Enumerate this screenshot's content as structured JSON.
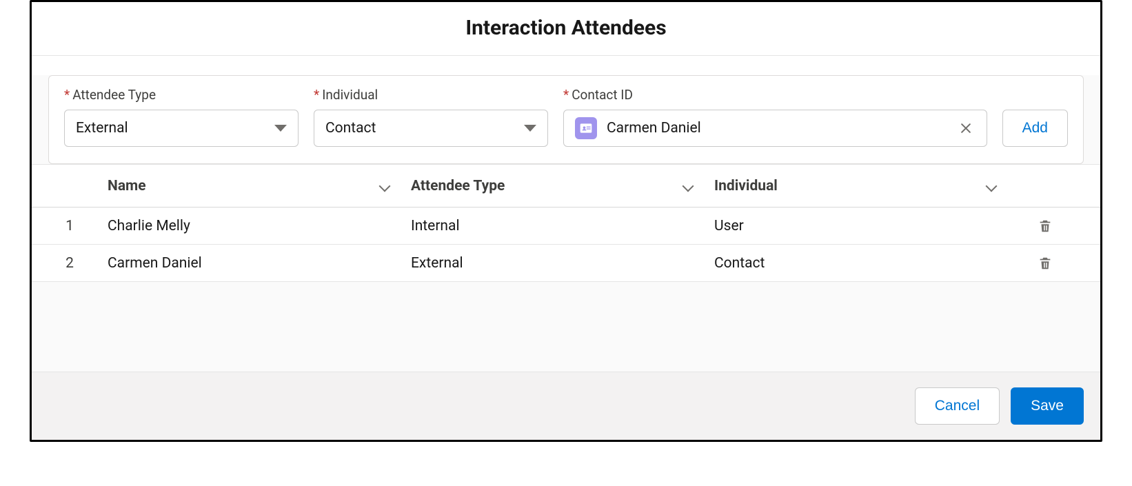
{
  "title": "Interaction Attendees",
  "form": {
    "attendeeType": {
      "label": "Attendee Type",
      "required": true,
      "value": "External"
    },
    "individual": {
      "label": "Individual",
      "required": true,
      "value": "Contact"
    },
    "contactId": {
      "label": "Contact ID",
      "required": true,
      "value": "Carmen Daniel"
    },
    "addLabel": "Add"
  },
  "grid": {
    "columns": {
      "name": "Name",
      "attendeeType": "Attendee Type",
      "individual": "Individual"
    },
    "rows": [
      {
        "idx": "1",
        "name": "Charlie Melly",
        "attendeeType": "Internal",
        "individual": "User"
      },
      {
        "idx": "2",
        "name": "Carmen Daniel",
        "attendeeType": "External",
        "individual": "Contact"
      }
    ]
  },
  "footer": {
    "cancel": "Cancel",
    "save": "Save"
  }
}
